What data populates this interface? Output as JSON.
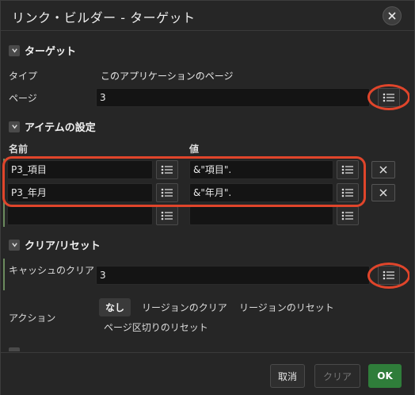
{
  "dialog": {
    "title": "リンク・ビルダー - ターゲット",
    "close_label": "close"
  },
  "target": {
    "section_title": "ターゲット",
    "type_label": "タイプ",
    "type_value": "このアプリケーションのページ",
    "page_label": "ページ",
    "page_value": "3"
  },
  "items": {
    "section_title": "アイテムの設定",
    "name_header": "名前",
    "value_header": "値",
    "rows": [
      {
        "name": "P3_項目",
        "value": "&\"項目\"."
      },
      {
        "name": "P3_年月",
        "value": "&\"年月\"."
      },
      {
        "name": "",
        "value": ""
      }
    ]
  },
  "clear": {
    "section_title": "クリア/リセット",
    "cache_label": "キャッシュのクリア",
    "cache_value": "3",
    "action_label": "アクション",
    "actions": [
      "なし",
      "リージョンのクリア",
      "リージョンのリセット",
      "ページ区切りのリセット"
    ]
  },
  "footer": {
    "cancel": "取消",
    "clear": "クリア",
    "ok": "OK"
  },
  "colors": {
    "highlight": "#e0452b",
    "ok_button": "#2f7d3a"
  }
}
